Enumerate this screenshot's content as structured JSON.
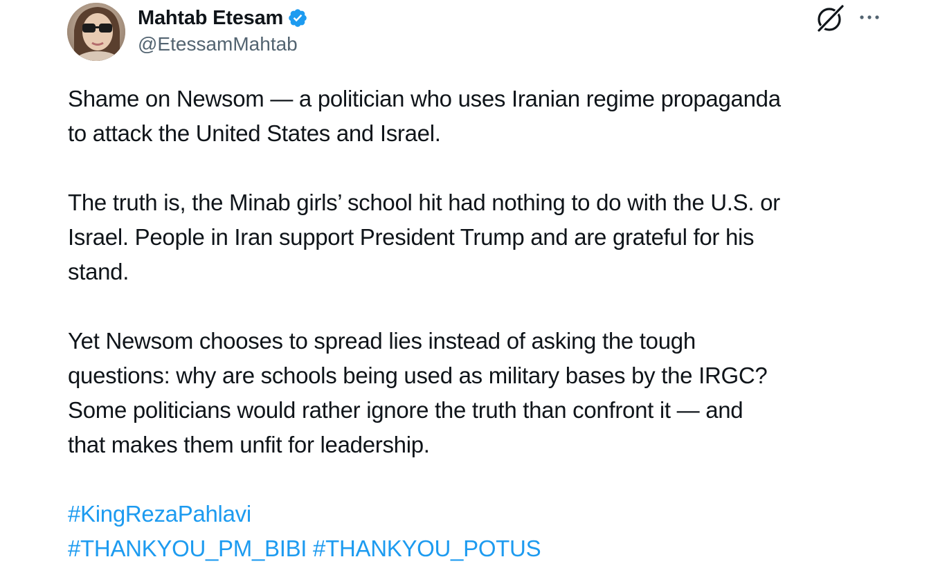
{
  "author": {
    "display_name": "Mahtab Etesam",
    "handle": "@EtessamMahtab",
    "verified": true,
    "verified_color": "#1d9bf0"
  },
  "icons": {
    "avatar": "profile-photo",
    "verified": "verified-badge-icon",
    "grok": "grok-icon",
    "more": "more-options-icon"
  },
  "tweet": {
    "paragraphs": [
      {
        "lines": [
          "Shame on Newsom — a politician who uses Iranian regime propaganda",
          "to attack the United States and Israel."
        ]
      },
      {
        "lines": [
          "The truth is, the Minab girls’ school hit had nothing to do with the U.S. or",
          "Israel. People in Iran support President Trump and are grateful for his",
          "stand."
        ]
      },
      {
        "lines": [
          "Yet Newsom chooses to spread lies instead of asking the tough",
          "questions: why are schools being used as military bases by the IRGC?",
          "Some politicians would rather ignore the truth than confront it — and",
          "that makes them unfit for leadership."
        ]
      }
    ],
    "hashtags": [
      "#KingRezaPahlavi",
      "#THANKYOU_PM_BIBI",
      "#THANKYOU_POTUS"
    ]
  },
  "colors": {
    "text": "#0f1419",
    "secondary": "#536471",
    "link": "#1d9bf0",
    "background": "#ffffff"
  }
}
